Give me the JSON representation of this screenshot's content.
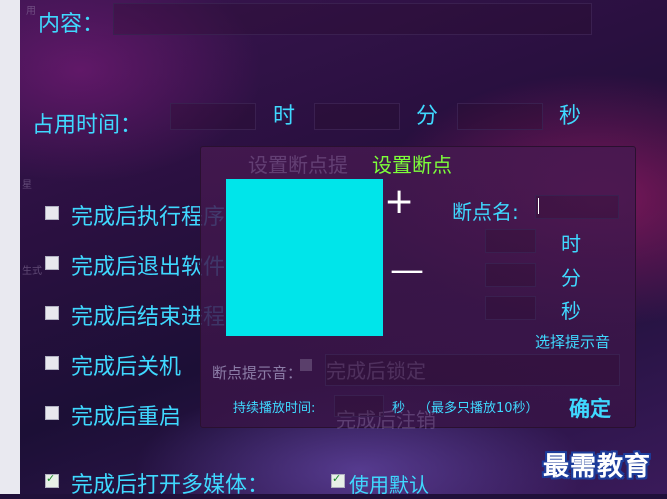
{
  "main": {
    "content_label": "内容：",
    "time_label": "占用时间：",
    "hour_unit": "时",
    "minute_unit": "分",
    "second_unit": "秒",
    "options": [
      {
        "label": "完成后执行程序：",
        "checked": false
      },
      {
        "label": "完成后退出软件",
        "checked": false
      },
      {
        "label": "完成后结束进程：",
        "checked": false
      },
      {
        "label": "完成后关机",
        "checked": false
      },
      {
        "label": "完成后重启",
        "checked": false
      },
      {
        "label": "完成后打开多媒体：",
        "checked": true
      }
    ],
    "use_default_label": "使用默认",
    "use_default_checked": true
  },
  "behind_dialog_ghosts": {
    "title": "设置断点提",
    "lock_label": "完成后锁定",
    "logout_label": "完成后注销"
  },
  "edge_fragments": [
    "用",
    "星",
    "生式"
  ],
  "dialog": {
    "title": "设置断点",
    "plus_symbol": "+",
    "minus_symbol": "—",
    "breakpoint_name_label": "断点名:",
    "breakpoint_name_value": "",
    "hour_unit": "时",
    "minute_unit": "分",
    "second_unit": "秒",
    "choose_sound_label": "选择提示音",
    "sound_label": "断点提示音：",
    "duration_label": "持续播放时间:",
    "duration_unit": "秒",
    "duration_note": "（最多只播放10秒）",
    "confirm_label": "确定"
  },
  "watermark": "最需教育",
  "colors": {
    "label_cyan": "#3fd9ff",
    "dialog_title": "#7dff3a",
    "preview_cyan": "#00e5ea"
  }
}
